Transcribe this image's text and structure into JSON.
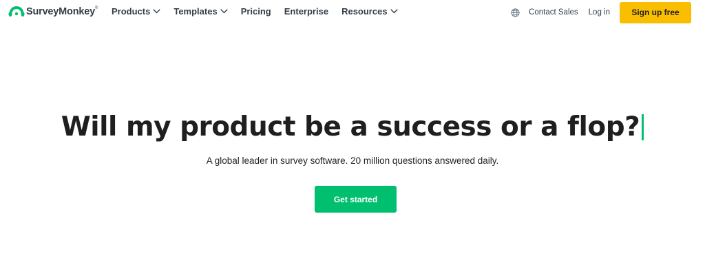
{
  "brand": {
    "name": "SurveyMonkey",
    "trademark": "®",
    "logo_icon": "surveymonkey-logo-icon",
    "color": "#00bf6f"
  },
  "nav": {
    "items": [
      {
        "label": "Products",
        "has_dropdown": true
      },
      {
        "label": "Templates",
        "has_dropdown": true
      },
      {
        "label": "Pricing",
        "has_dropdown": false
      },
      {
        "label": "Enterprise",
        "has_dropdown": false
      },
      {
        "label": "Resources",
        "has_dropdown": true
      }
    ],
    "dropdown_icon": "chevron-down-icon"
  },
  "header_right": {
    "language_icon": "globe-icon",
    "contact_sales": "Contact Sales",
    "login": "Log in",
    "signup": "Sign up free",
    "signup_color": "#f9be00"
  },
  "hero": {
    "headline": "Will my product be a success or a flop?",
    "caret_color": "#00bf6f",
    "subheadline": "A global leader in survey software. 20 million questions answered daily.",
    "cta": "Get started",
    "cta_color": "#00bf6f"
  }
}
